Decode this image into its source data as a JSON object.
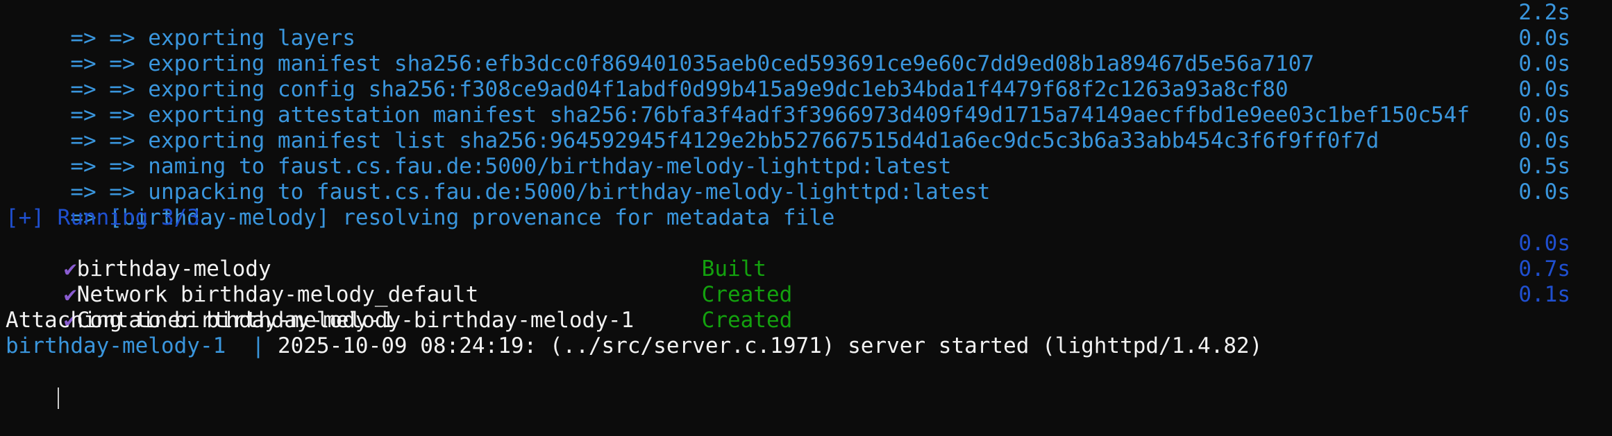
{
  "build_steps": [
    {
      "text": " => => exporting layers",
      "duration": "2.2s"
    },
    {
      "text": " => => exporting manifest sha256:efb3dcc0f869401035aeb0ced593691ce9e60c7dd9ed08b1a89467d5e56a7107",
      "duration": "0.0s"
    },
    {
      "text": " => => exporting config sha256:f308ce9ad04f1abdf0d99b415a9e9dc1eb34bda1f4479f68f2c1263a93a8cf80",
      "duration": "0.0s"
    },
    {
      "text": " => => exporting attestation manifest sha256:76bfa3f4adf3f3966973d409f49d1715a74149aecffbd1e9ee03c1bef150c54f",
      "duration": "0.0s"
    },
    {
      "text": " => => exporting manifest list sha256:964592945f4129e2bb527667515d4d1a6ec9dc5c3b6a33abb454c3f6f9ff0f7d",
      "duration": "0.0s"
    },
    {
      "text": " => => naming to faust.cs.fau.de:5000/birthday-melody-lighttpd:latest",
      "duration": "0.0s"
    },
    {
      "text": " => => unpacking to faust.cs.fau.de:5000/birthday-melody-lighttpd:latest",
      "duration": "0.5s"
    },
    {
      "text": " => [birthday-melody] resolving provenance for metadata file",
      "duration": "0.0s"
    }
  ],
  "running_header": "[+] Running 3/3",
  "services": [
    {
      "icon": "check-icon",
      "name": "birthday-melody",
      "status": "Built",
      "duration": "0.0s"
    },
    {
      "icon": "check-icon",
      "name": "Network birthday-melody_default",
      "status": "Created",
      "duration": "0.7s"
    },
    {
      "icon": "check-icon",
      "name": "Container birthday-melody-birthday-melody-1",
      "status": "Created",
      "duration": "0.1s"
    }
  ],
  "attach_line": "Attaching to birthday-melody-1",
  "log_line": {
    "prefix": "birthday-melody-1  | ",
    "message": "2025-10-09 08:24:19: (../src/server.c.1971) server started (lighttpd/1.4.82)"
  },
  "colors": {
    "background": "#0c0c0c",
    "build_text": "#3a96dd",
    "running": "#1f4fcf",
    "status": "#13a10e",
    "check": "#8a5cd1"
  }
}
